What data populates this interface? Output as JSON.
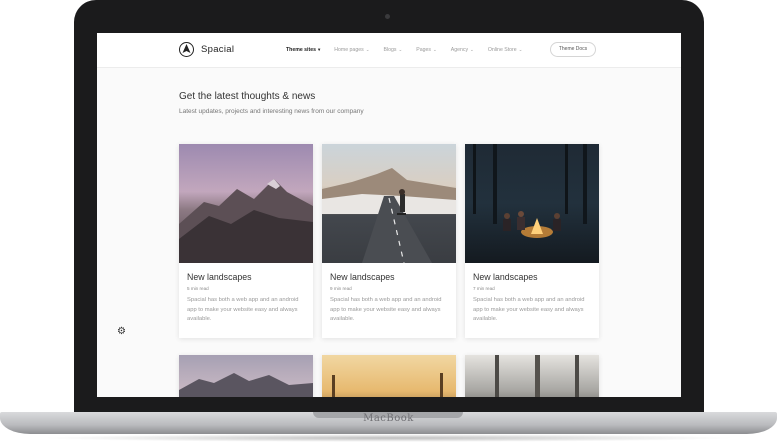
{
  "device": {
    "label": "MacBook"
  },
  "header": {
    "logo_text": "Spacial",
    "nav": [
      {
        "label": "Theme sites",
        "caret": "▾"
      },
      {
        "label": "Home pages",
        "caret": "⌄"
      },
      {
        "label": "Blogs",
        "caret": "⌄"
      },
      {
        "label": "Pages",
        "caret": "⌄"
      },
      {
        "label": "Agency",
        "caret": "⌄"
      },
      {
        "label": "Online Store",
        "caret": "⌄"
      }
    ],
    "docs_button": "Theme Docs"
  },
  "intro": {
    "title": "Get the latest thoughts & news",
    "subtitle": "Latest updates, projects and interesting news from our company"
  },
  "cards": [
    {
      "title": "New landscapes",
      "meta": "5 min read",
      "text": "Spacial has both a web app and an android app to make your website easy and always available."
    },
    {
      "title": "New landscapes",
      "meta": "9 min read",
      "text": "Spacial has both a web app and an android app to make your website easy and always available."
    },
    {
      "title": "New landscapes",
      "meta": "7 min read",
      "text": "Spacial has both a web app and an android app to make your website easy and always available."
    }
  ],
  "colors": {
    "accent": "#222222",
    "background": "#fafafa",
    "bezel": "#1b1b1c"
  },
  "icons": {
    "logo": "compass-arrow-icon",
    "settings": "gear-icon"
  }
}
